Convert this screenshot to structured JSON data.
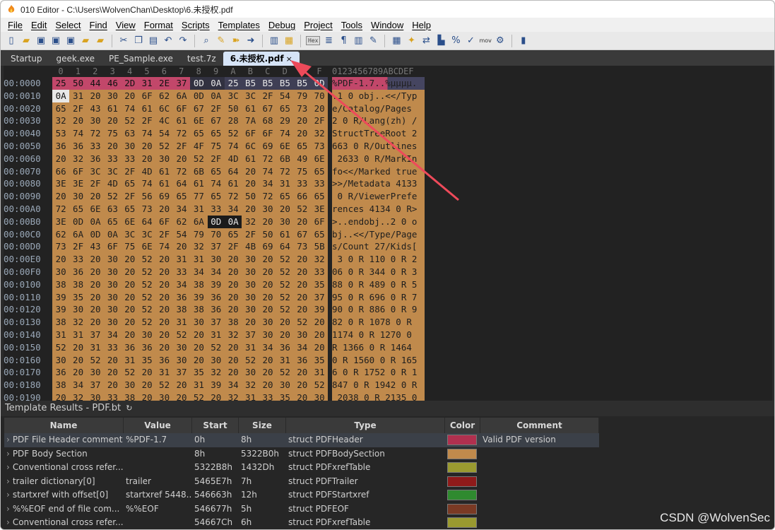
{
  "window": {
    "title": "010 Editor - C:\\Users\\WolvenChan\\Desktop\\6.未授权.pdf"
  },
  "menu": [
    "File",
    "Edit",
    "Select",
    "Find",
    "View",
    "Format",
    "Scripts",
    "Templates",
    "Debug",
    "Project",
    "Tools",
    "Window",
    "Help"
  ],
  "toolbar": {
    "hex_label": "Hex",
    "mov_label": "mov"
  },
  "tabs": [
    {
      "label": "Startup",
      "active": false
    },
    {
      "label": "geek.exe",
      "active": false
    },
    {
      "label": "PE_Sample.exe",
      "active": false
    },
    {
      "label": "test.7z",
      "active": false
    },
    {
      "label": "6.未授权.pdf",
      "active": true,
      "close": "×"
    }
  ],
  "hex": {
    "column_header": [
      "0",
      "1",
      "2",
      "3",
      "4",
      "5",
      "6",
      "7",
      "8",
      "9",
      "A",
      "B",
      "C",
      "D",
      "E",
      "F"
    ],
    "ascii_header": "0123456789ABCDEF",
    "rows": [
      {
        "offset": "00:0000",
        "bytes": "25 50 44 46 2D 31 2E 37 0D 0A 25 B5 B5 B5 B5 0D",
        "ascii": "%PDF-1.7..%µµµµ."
      },
      {
        "offset": "00:0010",
        "bytes": "0A 31 20 30 20 6F 62 6A 0D 0A 3C 3C 2F 54 79 70",
        "ascii": ".1 0 obj..<</Typ"
      },
      {
        "offset": "00:0020",
        "bytes": "65 2F 43 61 74 61 6C 6F 67 2F 50 61 67 65 73 20",
        "ascii": "e/Catalog/Pages "
      },
      {
        "offset": "00:0030",
        "bytes": "32 20 30 20 52 2F 4C 61 6E 67 28 7A 68 29 20 2F",
        "ascii": "2 0 R/Lang(zh) /"
      },
      {
        "offset": "00:0040",
        "bytes": "53 74 72 75 63 74 54 72 65 65 52 6F 6F 74 20 32",
        "ascii": "StructTreeRoot 2"
      },
      {
        "offset": "00:0050",
        "bytes": "36 36 33 20 30 20 52 2F 4F 75 74 6C 69 6E 65 73",
        "ascii": "663 0 R/Outlines"
      },
      {
        "offset": "00:0060",
        "bytes": "20 32 36 33 33 20 30 20 52 2F 4D 61 72 6B 49 6E",
        "ascii": " 2633 0 R/MarkIn"
      },
      {
        "offset": "00:0070",
        "bytes": "66 6F 3C 3C 2F 4D 61 72 6B 65 64 20 74 72 75 65",
        "ascii": "fo<</Marked true"
      },
      {
        "offset": "00:0080",
        "bytes": "3E 3E 2F 4D 65 74 61 64 61 74 61 20 34 31 33 33",
        "ascii": ">>/Metadata 4133"
      },
      {
        "offset": "00:0090",
        "bytes": "20 30 20 52 2F 56 69 65 77 65 72 50 72 65 66 65",
        "ascii": " 0 R/ViewerPrefe"
      },
      {
        "offset": "00:00A0",
        "bytes": "72 65 6E 63 65 73 20 34 31 33 34 20 30 20 52 3E",
        "ascii": "rences 4134 0 R>"
      },
      {
        "offset": "00:00B0",
        "bytes": "3E 0D 0A 65 6E 64 6F 62 6A 0D 0A 32 20 30 20 6F",
        "ascii": ">..endobj..2 0 o"
      },
      {
        "offset": "00:00C0",
        "bytes": "62 6A 0D 0A 3C 3C 2F 54 79 70 65 2F 50 61 67 65",
        "ascii": "bj..<</Type/Page"
      },
      {
        "offset": "00:00D0",
        "bytes": "73 2F 43 6F 75 6E 74 20 32 37 2F 4B 69 64 73 5B",
        "ascii": "s/Count 27/Kids["
      },
      {
        "offset": "00:00E0",
        "bytes": "20 33 20 30 20 52 20 31 31 30 20 30 20 52 20 32",
        "ascii": " 3 0 R 110 0 R 2"
      },
      {
        "offset": "00:00F0",
        "bytes": "30 36 20 30 20 52 20 33 34 34 20 30 20 52 20 33",
        "ascii": "06 0 R 344 0 R 3"
      },
      {
        "offset": "00:0100",
        "bytes": "38 38 20 30 20 52 20 34 38 39 20 30 20 52 20 35",
        "ascii": "88 0 R 489 0 R 5"
      },
      {
        "offset": "00:0110",
        "bytes": "39 35 20 30 20 52 20 36 39 36 20 30 20 52 20 37",
        "ascii": "95 0 R 696 0 R 7"
      },
      {
        "offset": "00:0120",
        "bytes": "39 30 20 30 20 52 20 38 38 36 20 30 20 52 20 39",
        "ascii": "90 0 R 886 0 R 9"
      },
      {
        "offset": "00:0130",
        "bytes": "38 32 20 30 20 52 20 31 30 37 38 20 30 20 52 20",
        "ascii": "82 0 R 1078 0 R "
      },
      {
        "offset": "00:0140",
        "bytes": "31 31 37 34 20 30 20 52 20 31 32 37 30 20 30 20",
        "ascii": "1174 0 R 1270 0 "
      },
      {
        "offset": "00:0150",
        "bytes": "52 20 31 33 36 36 20 30 20 52 20 31 34 36 34 20",
        "ascii": "R 1366 0 R 1464 "
      },
      {
        "offset": "00:0160",
        "bytes": "30 20 52 20 31 35 36 30 20 30 20 52 20 31 36 35",
        "ascii": "0 R 1560 0 R 165"
      },
      {
        "offset": "00:0170",
        "bytes": "36 20 30 20 52 20 31 37 35 32 20 30 20 52 20 31",
        "ascii": "6 0 R 1752 0 R 1"
      },
      {
        "offset": "00:0180",
        "bytes": "38 34 37 20 30 20 52 20 31 39 34 32 20 30 20 52",
        "ascii": "847 0 R 1942 0 R"
      },
      {
        "offset": "00:0190",
        "bytes": "20 32 30 33 38 20 30 20 52 20 32 31 33 35 20 30",
        "ascii": " 2038 0 R 2135 0"
      }
    ]
  },
  "template_results": {
    "title": "Template Results - PDF.bt",
    "refresh_icon": "refresh-icon",
    "columns": [
      "Name",
      "Value",
      "Start",
      "Size",
      "Type",
      "Color",
      "Comment"
    ],
    "rows": [
      {
        "name": "PDF File Header comment",
        "value": "%PDF-1.7",
        "start": "0h",
        "size": "8h",
        "type": "struct PDFHeader",
        "color": "#b0304f",
        "comment": "Valid PDF version"
      },
      {
        "name": "PDF Body Section",
        "value": "",
        "start": "8h",
        "size": "5322B0h",
        "type": "struct PDFBodySection",
        "color": "#c08a4c",
        "comment": ""
      },
      {
        "name": "Conventional cross refer...",
        "value": "",
        "start": "5322B8h",
        "size": "1432Dh",
        "type": "struct PDFxrefTable",
        "color": "#9a9a30",
        "comment": ""
      },
      {
        "name": "trailer dictionary[0]",
        "value": "trailer",
        "start": "5465E7h",
        "size": "7h",
        "type": "struct PDFTrailer",
        "color": "#8f1a1a",
        "comment": ""
      },
      {
        "name": "startxref with offset[0]",
        "value": "startxref 5448...",
        "start": "546663h",
        "size": "12h",
        "type": "struct PDFStartxref",
        "color": "#2f8a2f",
        "comment": ""
      },
      {
        "name": "%%EOF end of file com...",
        "value": "%%EOF",
        "start": "546677h",
        "size": "5h",
        "type": "struct PDFEOF",
        "color": "#7a3a24",
        "comment": ""
      },
      {
        "name": "Conventional cross refer...",
        "value": "",
        "start": "54667Ch",
        "size": "6h",
        "type": "struct PDFxrefTable",
        "color": "#9a9a30",
        "comment": ""
      }
    ]
  },
  "watermark": "CSDN @WolvenSec"
}
